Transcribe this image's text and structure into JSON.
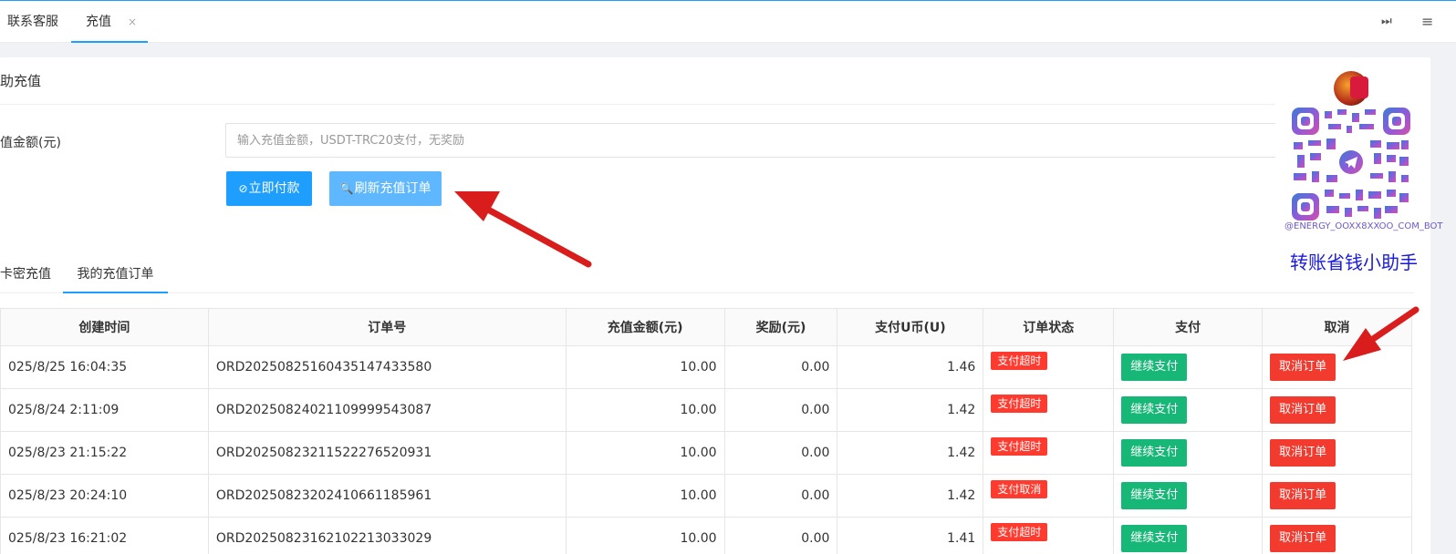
{
  "tabs": [
    {
      "label": "联系客服"
    },
    {
      "label": "充值",
      "close": "×"
    }
  ],
  "toolbar": {
    "next_icon": "⏭",
    "menu_icon": "≡"
  },
  "card": {
    "title": "助充值",
    "amount_label": "值金额(元)",
    "amount_placeholder": "输入充值金额，USDT-TRC20支付，无奖励",
    "pay_button": "立即付款",
    "refresh_button": "刷新充值订单"
  },
  "subtabs": [
    {
      "label": "卡密充值"
    },
    {
      "label": "我的充值订单"
    }
  ],
  "table": {
    "headers": [
      "创建时间",
      "订单号",
      "充值金额(元)",
      "奖励(元)",
      "支付U币(U)",
      "订单状态",
      "支付",
      "取消"
    ],
    "rows": [
      {
        "time": "025/8/25 16:04:35",
        "order": "ORD20250825160435147433580",
        "amount": "10.00",
        "reward": "0.00",
        "usdt": "1.46",
        "status": "支付超时",
        "pay": "继续支付",
        "cancel": "取消订单"
      },
      {
        "time": "025/8/24 2:11:09",
        "order": "ORD20250824021109999543087",
        "amount": "10.00",
        "reward": "0.00",
        "usdt": "1.42",
        "status": "支付超时",
        "pay": "继续支付",
        "cancel": "取消订单"
      },
      {
        "time": "025/8/23 21:15:22",
        "order": "ORD20250823211522276520931",
        "amount": "10.00",
        "reward": "0.00",
        "usdt": "1.42",
        "status": "支付超时",
        "pay": "继续支付",
        "cancel": "取消订单"
      },
      {
        "time": "025/8/23 20:24:10",
        "order": "ORD20250823202410661185961",
        "amount": "10.00",
        "reward": "0.00",
        "usdt": "1.42",
        "status": "支付取消",
        "pay": "继续支付",
        "cancel": "取消订单"
      },
      {
        "time": "025/8/23 16:21:02",
        "order": "ORD20250823162102213033029",
        "amount": "10.00",
        "reward": "0.00",
        "usdt": "1.41",
        "status": "支付超时",
        "pay": "继续支付",
        "cancel": "取消订单"
      }
    ]
  },
  "overlay": {
    "qr_caption": "@ENERGY_OOXX8XXOO_COM_BOT",
    "helper_text": "转账省钱小助手"
  },
  "colors": {
    "accent": "#1e9fff",
    "green": "#16b777",
    "red": "#f33a2e",
    "arrow": "#d91c1c"
  }
}
